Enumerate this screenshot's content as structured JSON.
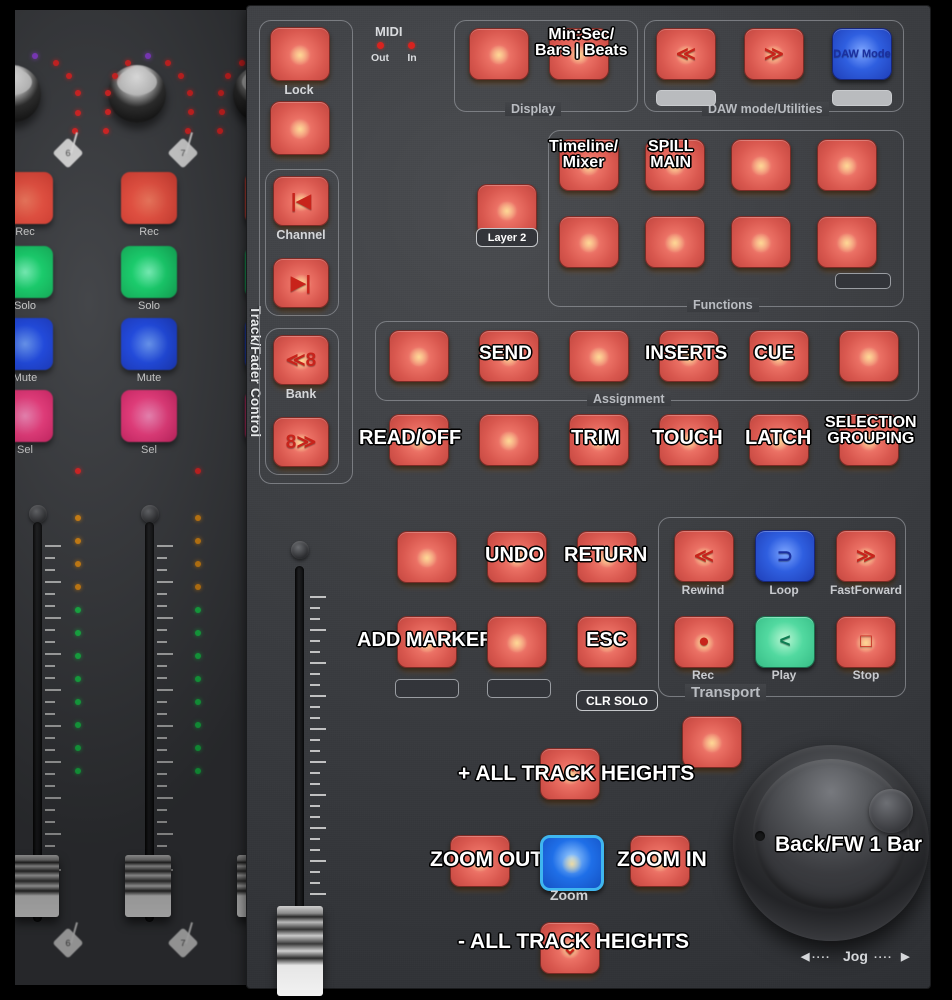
{
  "device": {
    "panel_label_vertical": "Track/Fader Control",
    "colors": {
      "button_red": "#e06a5f",
      "button_blue": "#2f5fe0",
      "button_green": "#52d9a0",
      "zoom_select_border": "#3fb6ef",
      "panel_bg": "#3c3e42",
      "led_red": "#d8231f"
    }
  },
  "midi": {
    "title": "MIDI",
    "out_label": "Out",
    "in_label": "In"
  },
  "track_fader_control": {
    "lock_label": "Lock",
    "channel_label": "Channel",
    "bank_label": "Bank",
    "channel_prev_symbol": "|◀",
    "channel_next_symbol": "▶|",
    "bank_prev_symbol": "≪8",
    "bank_next_symbol": "8≫"
  },
  "layer": {
    "label": "Layer 2"
  },
  "display_section": {
    "group_label": "Display",
    "mode_button_label": "Min:Sec/\nBars | Beats"
  },
  "daw_section": {
    "group_label": "DAW mode/Utilities",
    "prev_symbol": "≪",
    "next_symbol": "≫",
    "daw_mode_label": "DAW\nMode"
  },
  "functions_section": {
    "group_label": "Functions",
    "buttons": [
      {
        "label": "Timeline/\nMixer"
      },
      {
        "label": "SPILL\nMAIN"
      },
      {
        "label": ""
      },
      {
        "label": ""
      },
      {
        "label": ""
      },
      {
        "label": ""
      },
      {
        "label": ""
      },
      {
        "label": ""
      }
    ]
  },
  "assignment_section": {
    "group_label": "Assignment",
    "buttons": [
      {
        "label": ""
      },
      {
        "label": "SEND"
      },
      {
        "label": ""
      },
      {
        "label": "INSERTS"
      },
      {
        "label": "CUE"
      },
      {
        "label": ""
      }
    ]
  },
  "automation_row": {
    "buttons": [
      {
        "label": "READ/OFF"
      },
      {
        "label": ""
      },
      {
        "label": "TRIM"
      },
      {
        "label": "TOUCH"
      },
      {
        "label": "LATCH"
      },
      {
        "label": "SELECTION\nGROUPING"
      }
    ]
  },
  "edit_section": {
    "row1": [
      {
        "label": ""
      },
      {
        "label": "UNDO"
      },
      {
        "label": "RETURN"
      }
    ],
    "row2": [
      {
        "label": "ADD MARKER"
      },
      {
        "label": ""
      },
      {
        "label": "ESC"
      }
    ],
    "clr_solo_label": "CLR SOLO"
  },
  "transport_section": {
    "group_label": "Transport",
    "buttons": [
      {
        "label": "Rewind",
        "symbol": "≪",
        "color": "red"
      },
      {
        "label": "Loop",
        "symbol": "⊃",
        "color": "blue"
      },
      {
        "label": "FastForward",
        "symbol": "≫",
        "color": "red"
      },
      {
        "label": "Rec",
        "symbol": "●",
        "color": "red"
      },
      {
        "label": "Play",
        "symbol": "<",
        "color": "green"
      },
      {
        "label": "Stop",
        "symbol": "□",
        "color": "red"
      }
    ]
  },
  "navigation_section": {
    "up_label": "+ ALL TRACK HEIGHTS",
    "down_label": "- ALL TRACK HEIGHTS",
    "left_label": "ZOOM OUT",
    "right_label": "ZOOM IN",
    "center_label": "Zoom"
  },
  "jog_section": {
    "wheel_label": "Back/FW 1 Bar",
    "jog_label": "Jog",
    "jog_left_arrow": "◀",
    "jog_right_arrow": "▶"
  },
  "photo_channels": {
    "button_labels": [
      "Rec",
      "Solo",
      "Mute",
      "Sel"
    ],
    "strips": [
      {
        "number": "6"
      },
      {
        "number": "7"
      }
    ]
  }
}
